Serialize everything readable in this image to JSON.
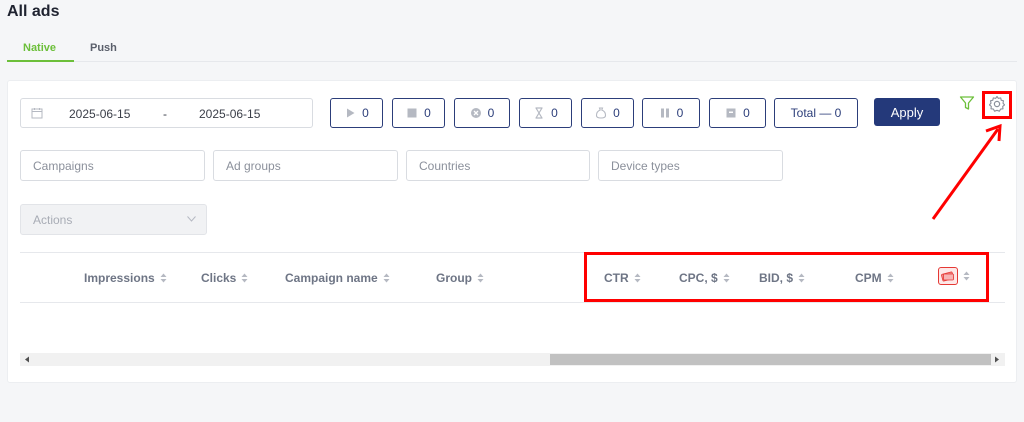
{
  "page": {
    "title": "All ads"
  },
  "tabs": [
    {
      "label": "Native",
      "active": true
    },
    {
      "label": "Push",
      "active": false
    }
  ],
  "date_range": {
    "from": "2025-06-15",
    "separator": "-",
    "to": "2025-06-15"
  },
  "status_filters": [
    {
      "icon": "play-icon",
      "count": "0"
    },
    {
      "icon": "stop-icon",
      "count": "0"
    },
    {
      "icon": "cancel-circle-icon",
      "count": "0"
    },
    {
      "icon": "hourglass-icon",
      "count": "0"
    },
    {
      "icon": "money-bag-icon",
      "count": "0"
    },
    {
      "icon": "pause-icon",
      "count": "0"
    },
    {
      "icon": "archive-icon",
      "count": "0"
    }
  ],
  "total": {
    "label": "Total — 0"
  },
  "apply": {
    "label": "Apply"
  },
  "filters": {
    "campaigns": "Campaigns",
    "ad_groups": "Ad groups",
    "countries": "Countries",
    "device_types": "Device types",
    "actions": "Actions"
  },
  "table": {
    "columns": [
      "Impressions",
      "Clicks",
      "Campaign name",
      "Group",
      "CTR",
      "CPC, $",
      "BID, $",
      "CPM"
    ],
    "last_column_icon": "money-icon"
  },
  "colors": {
    "accent_green": "#6cbf3a",
    "primary_blue": "#24397a",
    "highlight_red": "#ff0000"
  }
}
